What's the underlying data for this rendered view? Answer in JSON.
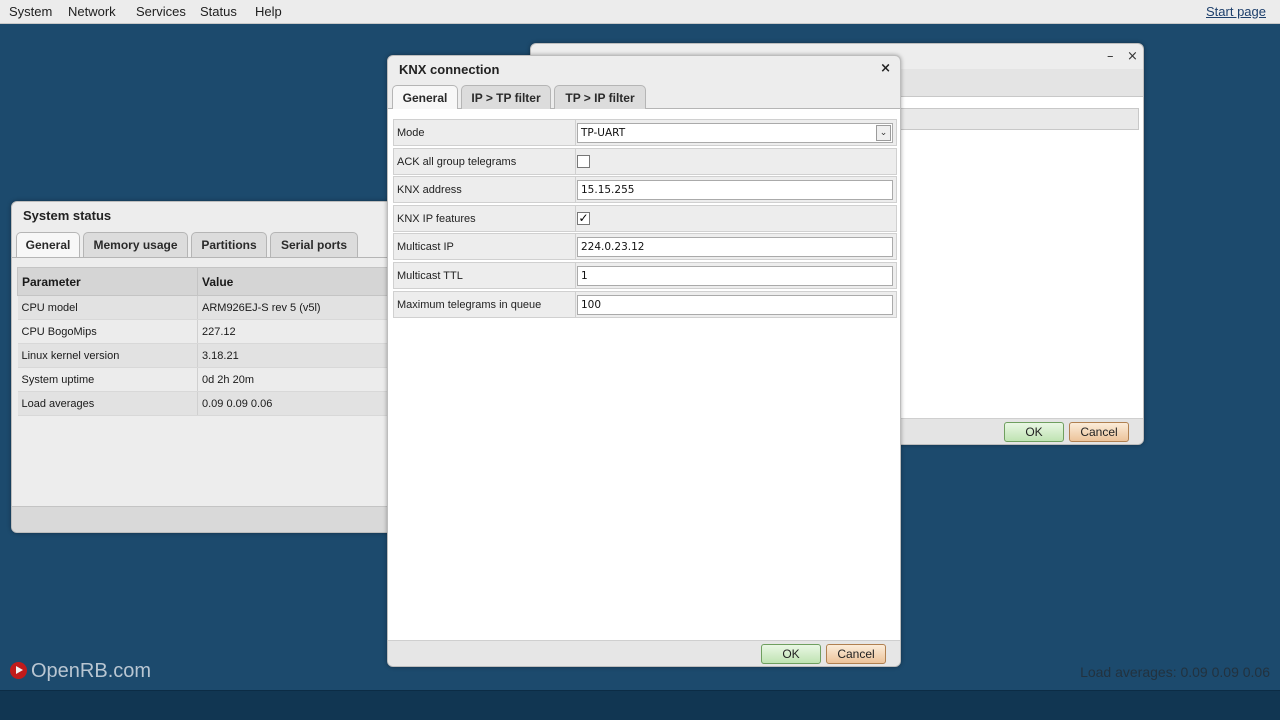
{
  "menu": {
    "items": [
      "System",
      "Network",
      "Services",
      "Status",
      "Help"
    ],
    "start_page": "Start page"
  },
  "network_window": {
    "ok": "OK",
    "cancel": "Cancel",
    "minimize_icon": "minimize-icon",
    "close_icon": "close-icon"
  },
  "system_status": {
    "title": "System status",
    "tabs": [
      "General",
      "Memory usage",
      "Partitions",
      "Serial ports"
    ],
    "columns": [
      "Parameter",
      "Value"
    ],
    "rows": [
      {
        "param": "CPU model",
        "value": "ARM926EJ-S rev 5 (v5l)"
      },
      {
        "param": "CPU BogoMips",
        "value": "227.12"
      },
      {
        "param": "Linux kernel version",
        "value": "3.18.21"
      },
      {
        "param": "System uptime",
        "value": "0d 2h 20m"
      },
      {
        "param": "Load averages",
        "value": "0.09 0.09 0.06"
      }
    ]
  },
  "knx_dialog": {
    "title": "KNX connection",
    "close": "×",
    "tabs": [
      "General",
      "IP > TP filter",
      "TP > IP filter"
    ],
    "fields": {
      "mode_label": "Mode",
      "mode_value": "TP-UART",
      "ack_label": "ACK all group telegrams",
      "ack_checked": false,
      "address_label": "KNX address",
      "address_value": "15.15.255",
      "ipfeatures_label": "KNX IP features",
      "ipfeatures_checked": true,
      "multicast_ip_label": "Multicast IP",
      "multicast_ip_value": "224.0.23.12",
      "multicast_ttl_label": "Multicast TTL",
      "multicast_ttl_value": "1",
      "max_tele_label": "Maximum telegrams in queue",
      "max_tele_value": "100"
    },
    "ok": "OK",
    "cancel": "Cancel"
  },
  "footer": {
    "logo": "OpenRB.com",
    "load_averages": "Load averages: 0.09 0.09 0.06"
  },
  "colors": {
    "desktop": "#1c4a6d",
    "ok_button": "#bfe3b2",
    "cancel_button": "#ecc39a"
  }
}
